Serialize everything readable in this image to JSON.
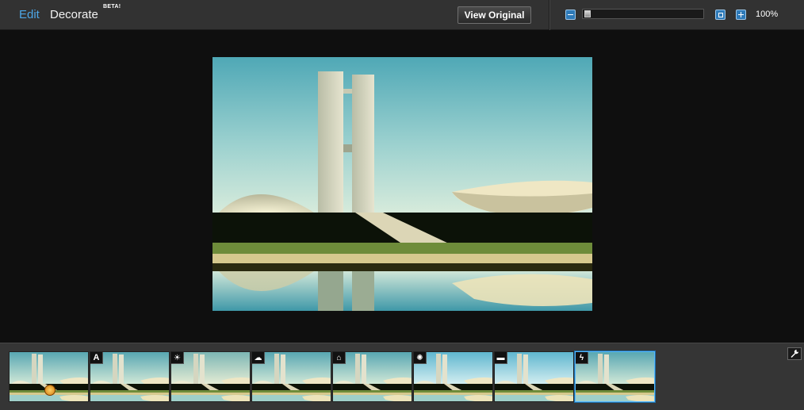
{
  "header": {
    "tabs": [
      {
        "label": "Edit",
        "active": true
      },
      {
        "label": "Decorate",
        "active": false
      }
    ],
    "beta_label": "BETA!",
    "view_original_label": "View Original"
  },
  "zoom": {
    "value_label": "100%",
    "slider_level_fraction": 0.0
  },
  "colors": {
    "accent": "#4da6e6",
    "selection": "#57b8ff",
    "topbar_bg": "#323232",
    "canvas_bg": "#0f0f0f",
    "strip_bg": "#353535"
  },
  "filmstrip": {
    "thumbnails": [
      {
        "effect_icon": "hand-pointer-icon",
        "badge": "",
        "tint": "none"
      },
      {
        "effect_icon": "auto-fix-icon",
        "badge": "A",
        "tint": "none"
      },
      {
        "effect_icon": "brightness-sun-icon",
        "badge": "",
        "tint": "warm"
      },
      {
        "effect_icon": "cloud-icon",
        "badge": "",
        "tint": "none"
      },
      {
        "effect_icon": "house-icon",
        "badge": "",
        "tint": "none"
      },
      {
        "effect_icon": "light-bulb-icon",
        "badge": "",
        "tint": "cool"
      },
      {
        "effect_icon": "flash-burst-icon",
        "badge": "",
        "tint": "cool"
      },
      {
        "effect_icon": "lightning-icon",
        "badge": "",
        "tint": "none",
        "selected": true
      }
    ],
    "tools_icon": "wrench-icon"
  }
}
